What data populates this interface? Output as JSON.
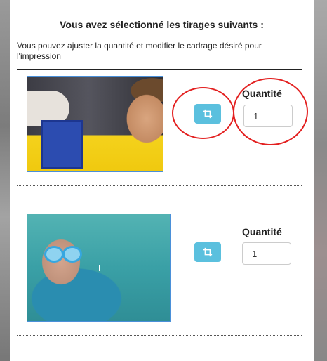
{
  "dialog": {
    "title": "Vous avez sélectionné les tirages suivants :",
    "subtitle": "Vous pouvez ajuster la quantité et modifier le cadrage désiré pour l'impression"
  },
  "prints": [
    {
      "photo_alt": "Enfant jouant au Puissance 4",
      "crop_icon": "crop-icon",
      "quantity_label": "Quantité",
      "quantity_value": "1"
    },
    {
      "photo_alt": "Enfant nageant sous l'eau avec lunettes",
      "crop_icon": "crop-icon",
      "quantity_label": "Quantité",
      "quantity_value": "1"
    }
  ],
  "colors": {
    "crop_button": "#5bc0de",
    "annotation": "#e32020",
    "focus_border": "#4a90d9"
  }
}
